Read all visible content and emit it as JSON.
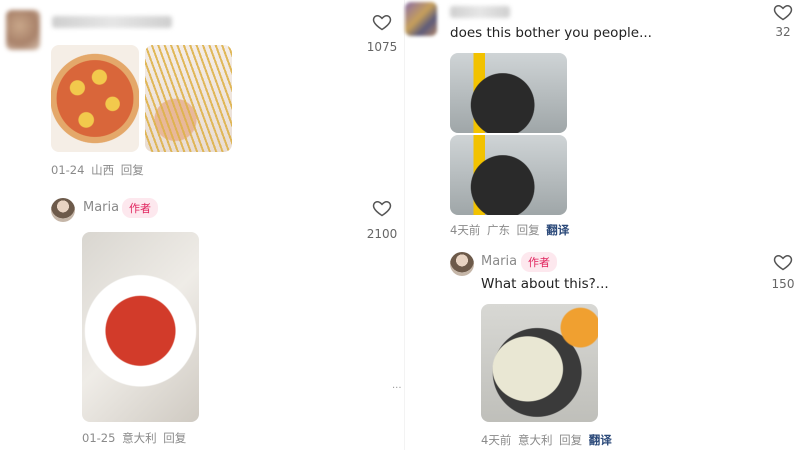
{
  "left_column": {
    "comment_1": {
      "user_name": "",
      "like_count": "1075",
      "images": [
        "pizza-photo",
        "pasta-photo"
      ],
      "meta": {
        "date": "01-24",
        "location": "山西",
        "reply": "回复"
      }
    },
    "reply_1": {
      "user_name": "Maria",
      "badge": "作者",
      "like_count": "2100",
      "images": [
        "strawberry-plate-photo"
      ],
      "meta": {
        "date": "01-25",
        "location": "意大利",
        "reply": "回复"
      }
    }
  },
  "right_column": {
    "comment_1": {
      "user_name": "",
      "text": "does this bother you people...",
      "like_count": "32",
      "images": [
        "pot-photo-top",
        "pot-photo-bottom"
      ],
      "meta": {
        "date": "4天前",
        "location": "广东",
        "reply": "回复",
        "translate": "翻译"
      }
    },
    "reply_1": {
      "user_name": "Maria",
      "badge": "作者",
      "text": "What about this?...",
      "like_count": "150",
      "images": [
        "dumpling-photo"
      ],
      "meta": {
        "date": "4天前",
        "location": "意大利",
        "reply": "回复",
        "translate": "翻译"
      }
    }
  },
  "ellipsis": "...",
  "colors": {
    "badge_text": "#e0245e",
    "badge_bg": "#fde8ee",
    "translate_text": "#2c4a7a",
    "meta_text": "#8a8a8a"
  }
}
